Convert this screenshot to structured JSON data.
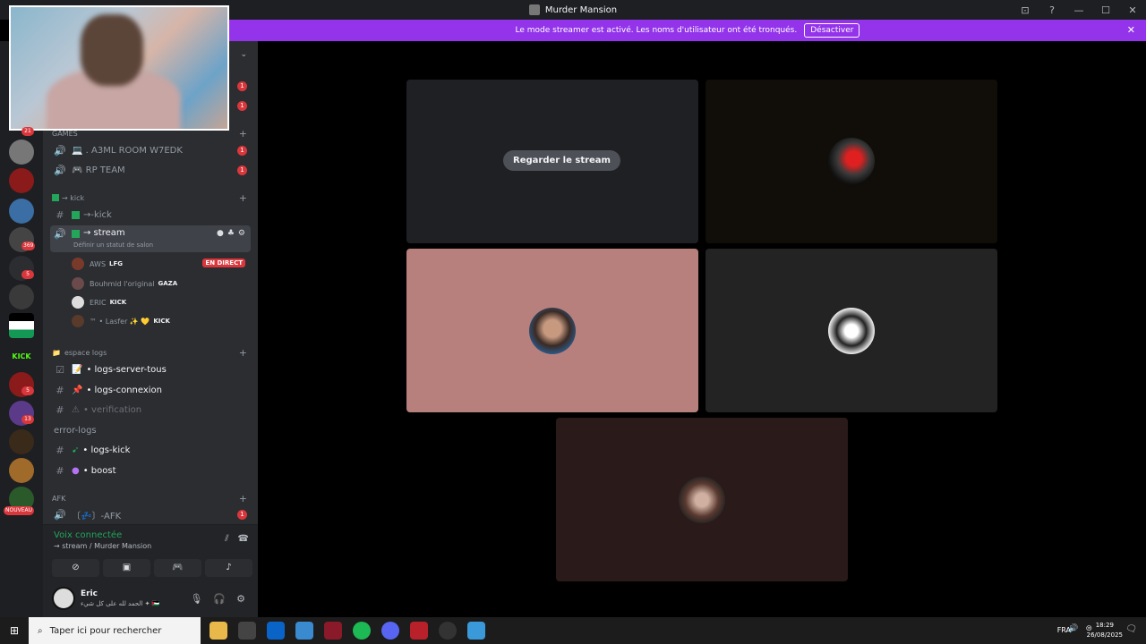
{
  "window": {
    "title": "Murder Mansion",
    "controls": [
      "⊡",
      "?",
      "—",
      "☐",
      "✕"
    ]
  },
  "banner": {
    "text": "Le mode streamer est activé. Les noms d'utilisateur ont été tronqués.",
    "button": "Désactiver",
    "close": "✕"
  },
  "rail": {
    "badges": [
      "21",
      "369",
      "5",
      "5",
      "13"
    ],
    "labels": {
      "kick": "KICK",
      "nouveau": "NOUVEAU"
    }
  },
  "sidebar": {
    "categories": {
      "games": "GAMES",
      "kick": "→ kick",
      "espace_logs": "espace logs",
      "afk": "AFK"
    },
    "channels": {
      "a3ml": "💻 . A3ML ROOM W7EDK",
      "rp_team": "🎮 RP TEAM",
      "kick": "→-kick",
      "stream": "→ stream",
      "stream_status": "Définir un statut de salon",
      "logs_server": "• logs-server-tous",
      "logs_connexion": "• logs-connexion",
      "verification": "• verification",
      "error_logs": "error-logs",
      "logs_kick": "• logs-kick",
      "boost": "• boost",
      "afk": "〔💤〕-AFK"
    },
    "mentions": [
      "1",
      "1",
      "1",
      "1",
      "1"
    ],
    "voice_users": [
      {
        "name": "AWS",
        "tag": "LFG",
        "live": "EN DIRECT"
      },
      {
        "name": "Bouhmid l'original",
        "tag": "GAZA"
      },
      {
        "name": "ERIC",
        "tag": "KICK"
      },
      {
        "name": "™ • Lasfer ✨ 💛",
        "tag": "KICK"
      }
    ]
  },
  "voice_panel": {
    "status": "Voix connectée",
    "location": "→ stream / Murder Mansion"
  },
  "user_panel": {
    "name": "Eric",
    "status": "الحمد لله على كل شيء ✦ 🇵🇸"
  },
  "stage": {
    "watch_button": "Regarder le stream"
  },
  "taskbar": {
    "search": "Taper ici pour rechercher",
    "lang": "FRA",
    "time": "18:29",
    "date": "26/08/2025"
  },
  "colors": {
    "accent": "#9333ea",
    "online": "#23a55a",
    "danger": "#da373c"
  }
}
